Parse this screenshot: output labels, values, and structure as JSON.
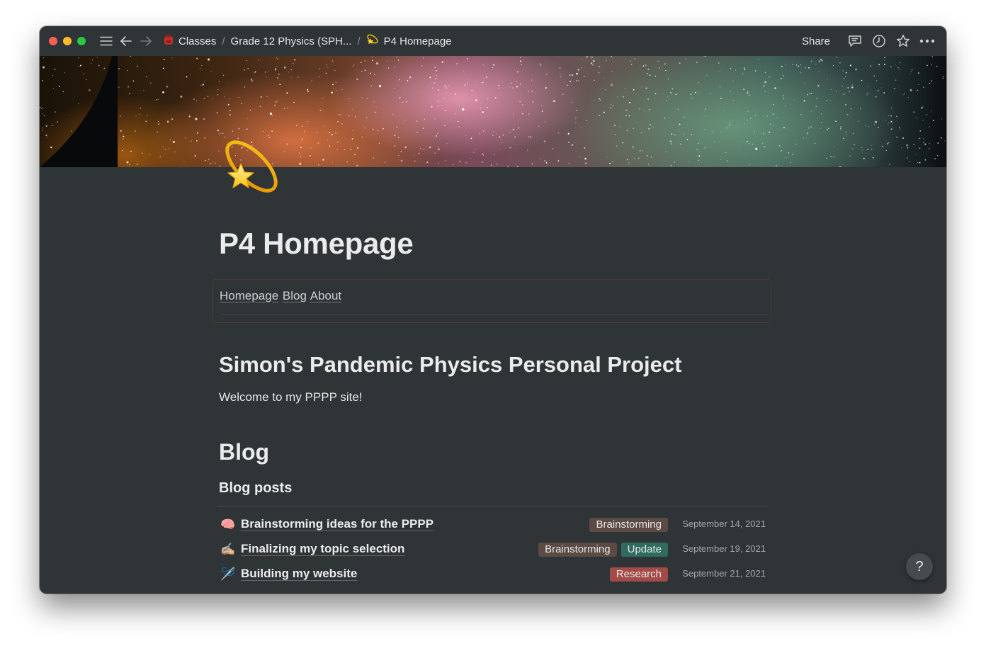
{
  "breadcrumb": {
    "items": [
      {
        "label": "Classes",
        "icon": "backpack-icon"
      },
      {
        "label": "Grade 12 Physics (SPH..."
      },
      {
        "label": "P4 Homepage",
        "icon": "dizzy-star-icon"
      }
    ],
    "separator": "/"
  },
  "toolbar": {
    "share_label": "Share"
  },
  "page": {
    "title": "P4 Homepage",
    "icon": "dizzy-star-icon"
  },
  "nav": {
    "links": [
      "Homepage",
      "Blog",
      "About"
    ]
  },
  "intro": {
    "heading": "Simon's Pandemic Physics Personal Project",
    "text": "Welcome to my PPPP site!"
  },
  "blog": {
    "heading": "Blog",
    "subheading": "Blog posts",
    "posts": [
      {
        "emoji": "🧠",
        "title": "Brainstorming ideas for the PPPP",
        "tags": [
          {
            "label": "Brainstorming",
            "color": "#5c4b45"
          }
        ],
        "date": "September 14, 2021"
      },
      {
        "emoji": "✍🏼",
        "title": "Finalizing my topic selection",
        "tags": [
          {
            "label": "Brainstorming",
            "color": "#5c4b45"
          },
          {
            "label": "Update",
            "color": "#2f6b5f"
          }
        ],
        "date": "September 19, 2021"
      },
      {
        "emoji": "🪡",
        "title": "Building my website",
        "tags": [
          {
            "label": "Research",
            "color": "#a34b48"
          }
        ],
        "date": "September 21, 2021"
      }
    ]
  },
  "help": {
    "label": "?"
  }
}
